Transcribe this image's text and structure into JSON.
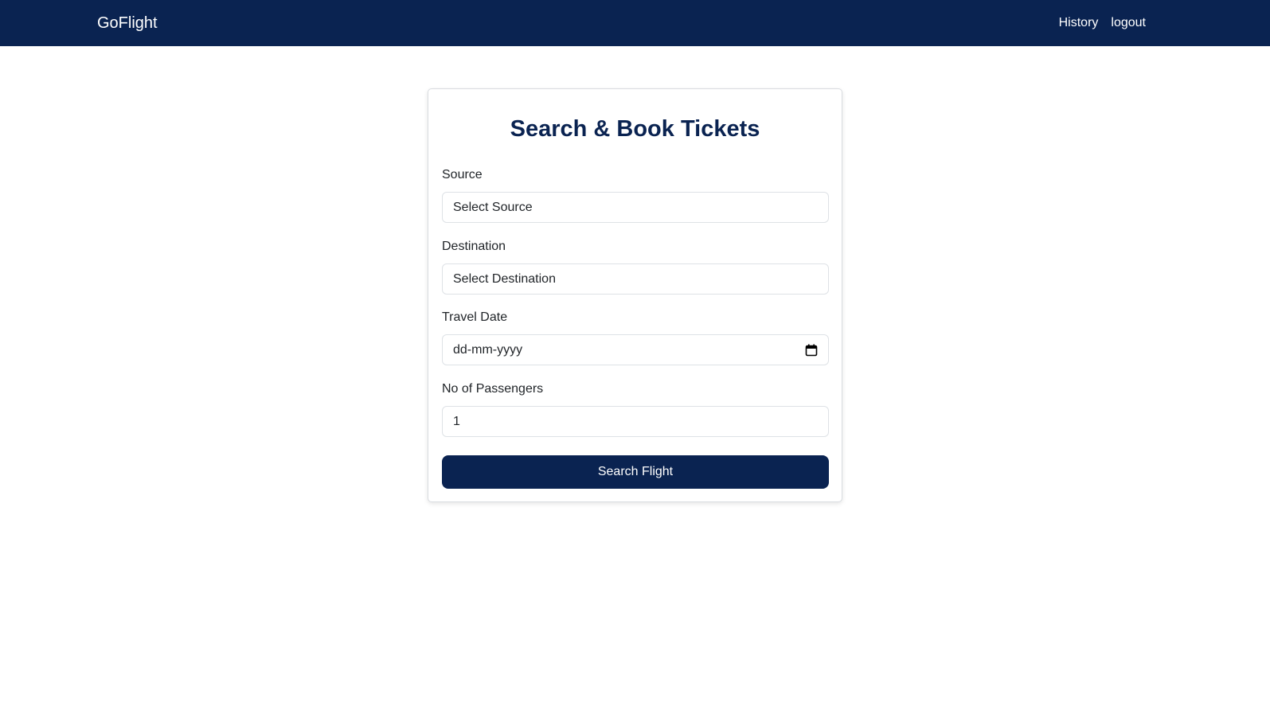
{
  "navbar": {
    "brand": "GoFlight",
    "links": [
      "History",
      "logout"
    ],
    "background": "#0a2351"
  },
  "form": {
    "title": "Search & Book Tickets",
    "source": {
      "label": "Source",
      "value": "Select Source"
    },
    "destination": {
      "label": "Destination",
      "value": "Select Destination"
    },
    "travel_date": {
      "label": "Travel Date",
      "placeholder": "dd-mm-yyyy",
      "icon": "calendar-icon"
    },
    "passengers": {
      "label": "No of Passengers",
      "value": "1"
    },
    "submit_label": "Search Flight"
  },
  "colors": {
    "primary": "#0a2351",
    "text": "#212529",
    "border": "#dee2e6"
  }
}
